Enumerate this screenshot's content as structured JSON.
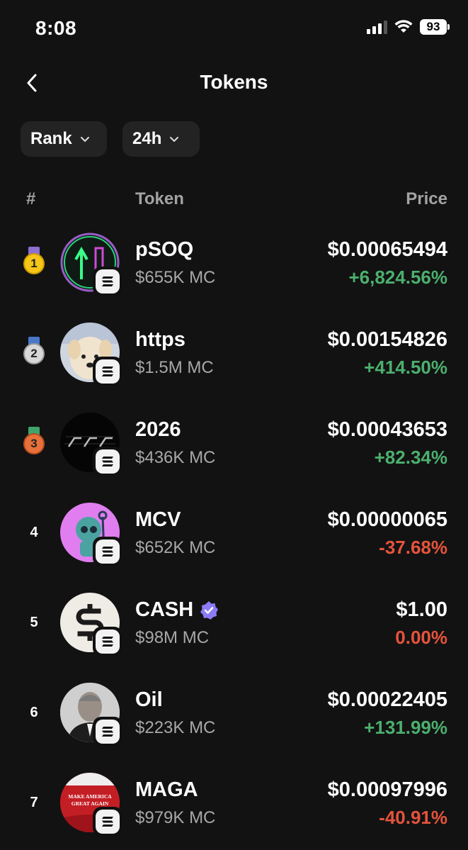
{
  "status_bar": {
    "time": "8:08",
    "battery": "93"
  },
  "header": {
    "title": "Tokens"
  },
  "filters": {
    "rank": "Rank",
    "period": "24h"
  },
  "columns": {
    "num": "#",
    "token": "Token",
    "price": "Price"
  },
  "tokens": [
    {
      "rank": "1",
      "name": "pSOQ",
      "mc": "$655K MC",
      "price": "$0.00065494",
      "change": "+6,824.56%",
      "trend": "up",
      "medal": "gold"
    },
    {
      "rank": "2",
      "name": "https",
      "mc": "$1.5M MC",
      "price": "$0.00154826",
      "change": "+414.50%",
      "trend": "up",
      "medal": "silver"
    },
    {
      "rank": "3",
      "name": "2026",
      "mc": "$436K MC",
      "price": "$0.00043653",
      "change": "+82.34%",
      "trend": "up",
      "medal": "bronze"
    },
    {
      "rank": "4",
      "name": "MCV",
      "mc": "$652K MC",
      "price": "$0.00000065",
      "change": "-37.68%",
      "trend": "down"
    },
    {
      "rank": "5",
      "name": "CASH",
      "mc": "$98M MC",
      "price": "$1.00",
      "change": "0.00%",
      "trend": "flat",
      "verified": true
    },
    {
      "rank": "6",
      "name": "Oil",
      "mc": "$223K MC",
      "price": "$0.00022405",
      "change": "+131.99%",
      "trend": "up"
    },
    {
      "rank": "7",
      "name": "MAGA",
      "mc": "$979K MC",
      "price": "$0.00097996",
      "change": "-40.91%",
      "trend": "down",
      "avatar_text": "MAKE AMERICA GREAT AGAIN"
    }
  ],
  "colors": {
    "positive": "#4caf6e",
    "negative": "#e5533c",
    "background": "#121212",
    "verified": "#8b7cf6"
  }
}
